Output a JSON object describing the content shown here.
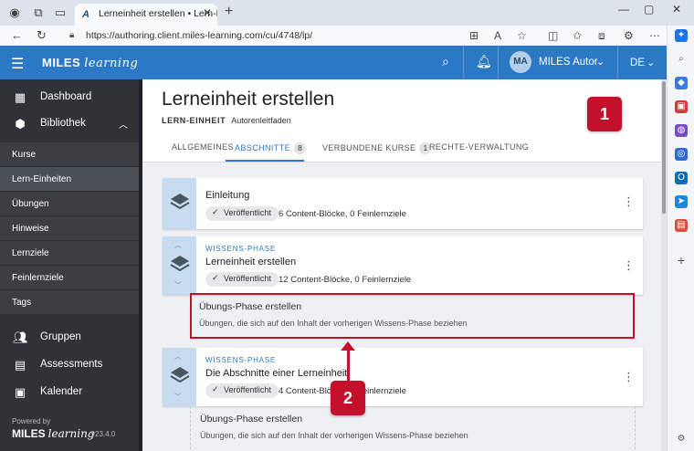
{
  "browser": {
    "tab_title": "Lerneinheit erstellen • Lern-Einhe",
    "url": "https://authoring.client.miles-learning.com/cu/4748/lp/",
    "new_tab": "+",
    "close_tab": "✕"
  },
  "appbar": {
    "logo_brand": "MILES",
    "logo_script": "learning",
    "avatar_initials": "MA",
    "user_name": "MILES Autor",
    "language": "DE"
  },
  "sidebar": {
    "main_items": [
      {
        "label": "Dashboard",
        "icon": "dashboard-icon"
      },
      {
        "label": "Bibliothek",
        "icon": "library-icon"
      }
    ],
    "library_items": [
      "Kurse",
      "Lern-Einheiten",
      "Übungen",
      "Hinweise",
      "Lernziele",
      "Feinlernziele",
      "Tags"
    ],
    "bottom_items": [
      {
        "label": "Gruppen",
        "icon": "groups-icon"
      },
      {
        "label": "Assessments",
        "icon": "assessments-icon"
      },
      {
        "label": "Kalender",
        "icon": "calendar-icon"
      }
    ],
    "powered_by": "Powered by",
    "brand": "MILES",
    "brand_script": "learning",
    "version": "v23.4.0"
  },
  "page": {
    "title": "Lerneinheit erstellen",
    "kind": "LERN-EINHEIT",
    "subtitle": "Autorenleitfaden",
    "tabs": [
      {
        "label": "ALLGEMEINES"
      },
      {
        "label": "ABSCHNITTE",
        "badge": "8"
      },
      {
        "label": "VERBUNDENE KURSE",
        "badge": "1"
      },
      {
        "label": "RECHTE-VERWALTUNG"
      }
    ]
  },
  "sections": [
    {
      "title": "Einleitung",
      "status": "Veröffentlicht",
      "meta": "6 Content-Blöcke, 0 Feinlernziele"
    },
    {
      "phase": "WISSENS-PHASE",
      "title": "Lerneinheit erstellen",
      "status": "Veröffentlicht",
      "meta": "12 Content-Blöcke, 0 Feinlernziele"
    },
    {
      "phase": "WISSENS-PHASE",
      "title": "Die Abschnitte einer Lerneinheit",
      "status": "Veröffentlicht",
      "meta": "4 Content-Blöcke, 0 Feinlernziele"
    }
  ],
  "practice_phases": [
    {
      "title": "Übungs-Phase erstellen",
      "description": "Übungen, die sich auf den Inhalt der vorherigen Wissens-Phase beziehen"
    },
    {
      "title": "Übungs-Phase erstellen",
      "description": "Übungen, die sich auf den Inhalt der vorherigen Wissens-Phase beziehen"
    }
  ],
  "annotations": {
    "callout_1": "1",
    "callout_2": "2",
    "color": "#c4112b"
  },
  "colors": {
    "appbar": "#2b78c5",
    "sidebar": "#2f3338",
    "card_side": "#c7dcef"
  }
}
